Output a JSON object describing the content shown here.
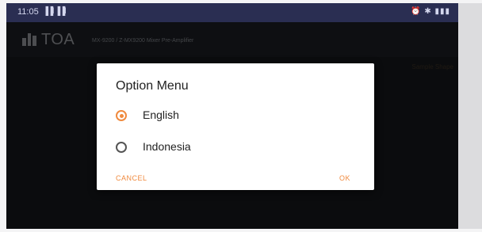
{
  "statusbar": {
    "time": "11:05",
    "signal": "▐▐l ▐▐l",
    "right": "⏰ ✱ ▮▮▮"
  },
  "app": {
    "brand": "TOA",
    "model": "MX-9200 / Z-MX9200 Mixer Pre-Amplifier",
    "bg_hint": "Sample Shape"
  },
  "dialog": {
    "title": "Option Menu",
    "options": [
      {
        "label": "English",
        "selected": true
      },
      {
        "label": "Indonesia",
        "selected": false
      }
    ],
    "cancel_label": "CANCEL",
    "ok_label": "OK"
  },
  "colors": {
    "accent": "#f08a3e",
    "statusbar": "#2a2e52",
    "app_bg": "#15171a"
  }
}
